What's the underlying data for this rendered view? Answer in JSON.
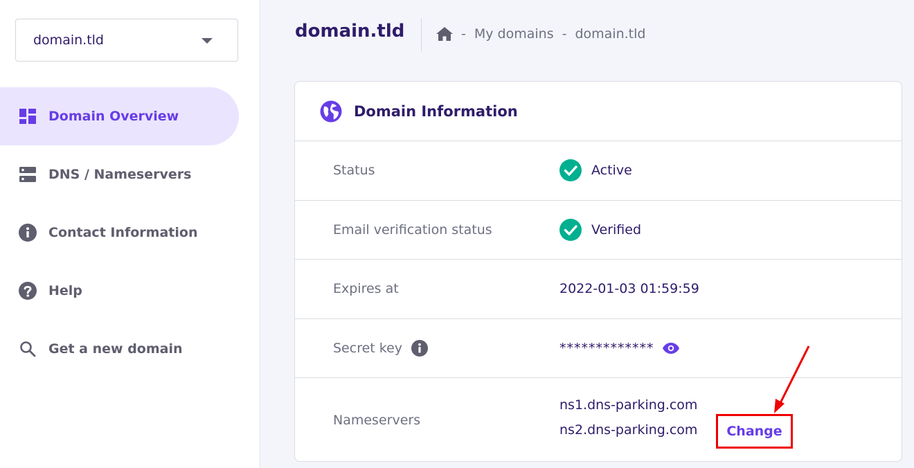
{
  "sidebar": {
    "domain_select": {
      "value": "domain.tld"
    },
    "items": [
      {
        "label": "Domain Overview",
        "icon": "dashboard-icon",
        "active": true
      },
      {
        "label": "DNS / Nameservers",
        "icon": "server-icon"
      },
      {
        "label": "Contact Information",
        "icon": "info-icon"
      },
      {
        "label": "Help",
        "icon": "help-icon"
      },
      {
        "label": "Get a new domain",
        "icon": "search-icon"
      }
    ]
  },
  "header": {
    "title": "domain.tld",
    "breadcrumb": {
      "home_icon": "home-icon",
      "sep": "-",
      "items": [
        "My domains",
        "domain.tld"
      ]
    }
  },
  "card": {
    "icon": "globe-icon",
    "title": "Domain Information",
    "rows": {
      "status": {
        "label": "Status",
        "value": "Active"
      },
      "email": {
        "label": "Email verification status",
        "value": "Verified"
      },
      "expires": {
        "label": "Expires at",
        "value": "2022-01-03 01:59:59"
      },
      "secret": {
        "label": "Secret key",
        "value": "*************"
      },
      "nameservers": {
        "label": "Nameservers",
        "ns1": "ns1.dns-parking.com",
        "ns2": "ns2.dns-parking.com",
        "change_label": "Change"
      }
    }
  },
  "colors": {
    "accent": "#673de6",
    "success": "#00b090",
    "highlight": "#f00000",
    "active_bg": "#ebe4ff"
  }
}
